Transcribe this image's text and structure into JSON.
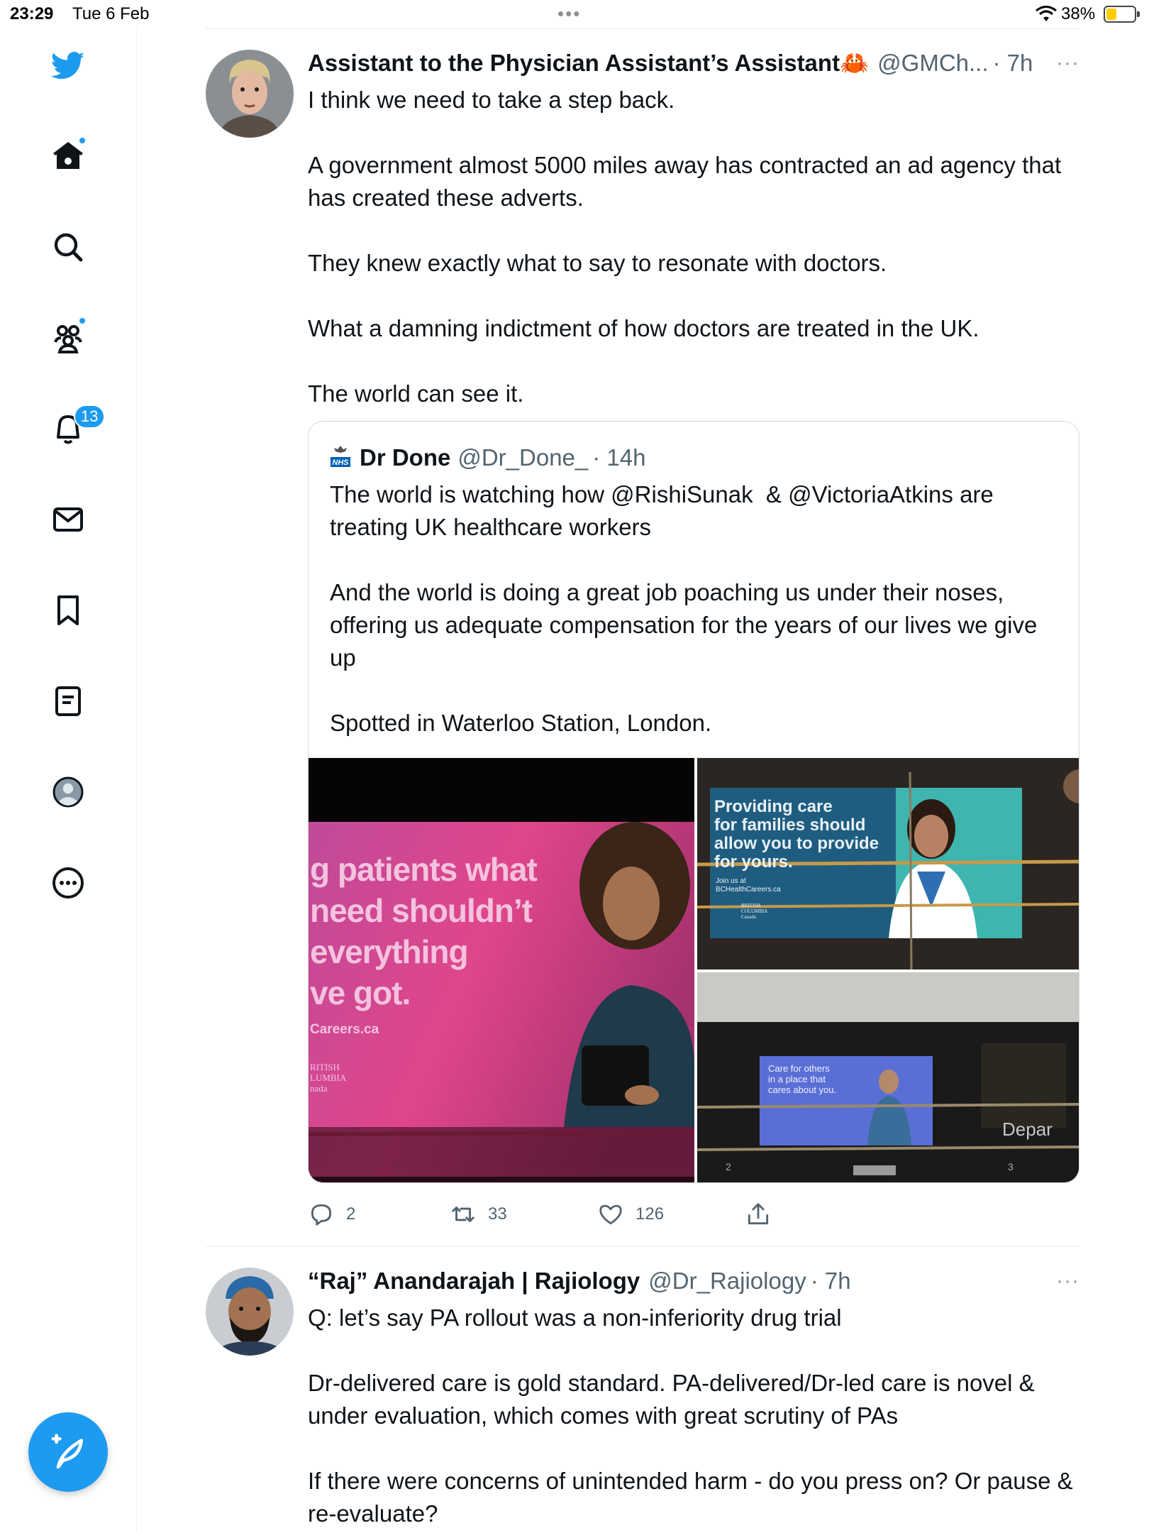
{
  "status_bar": {
    "time": "23:29",
    "date": "Tue 6 Feb",
    "battery_percent": "38%",
    "battery_level": 0.38
  },
  "sidebar": {
    "items": [
      {
        "name": "logo",
        "icon": "twitter-bird-icon"
      },
      {
        "name": "home",
        "icon": "home-icon",
        "dot": true
      },
      {
        "name": "explore",
        "icon": "search-icon"
      },
      {
        "name": "communities",
        "icon": "communities-icon",
        "dot": true
      },
      {
        "name": "notifications",
        "icon": "bell-icon",
        "badge": "13"
      },
      {
        "name": "messages",
        "icon": "mail-icon"
      },
      {
        "name": "bookmarks",
        "icon": "bookmark-icon"
      },
      {
        "name": "lists",
        "icon": "list-icon"
      },
      {
        "name": "profile",
        "icon": "profile-icon"
      },
      {
        "name": "more",
        "icon": "more-circle-icon"
      }
    ],
    "compose_icon": "compose-feather-icon"
  },
  "tweets": [
    {
      "name": "Assistant to the Physician Assistant’s Assistant🦀",
      "handle": "@GMCh...",
      "time": "· 7h",
      "more": "···",
      "text": "I think we need to take a step back.\n\nA government almost 5000 miles away has contracted an ad agency that has created these adverts.\n\nThey knew exactly what to say to resonate with doctors.\n\nWhat a damning indictment of how doctors are treated in the UK.\n\nThe world can see it.",
      "quote": {
        "name": "Dr Done",
        "handle": "@Dr_Done_",
        "time": "· 14h",
        "badge": "NHS",
        "text": "The world is watching how @RishiSunak  & @VictoriaAtkins are treating UK healthcare workers\n\nAnd the world is doing a great job poaching us under their noses, offering us adequate compensation for the years of our lives we give up\n\nSpotted in Waterloo Station, London.",
        "images": [
          {
            "lines": [
              "g patients what",
              "need shouldn’t",
              "everything",
              "ve got."
            ],
            "footer": "Careers.ca",
            "footer2": [
              "RITISH",
              "LUMBIA",
              "nada"
            ]
          },
          {
            "lines": [
              "Providing care",
              "for families should",
              "allow you to provide",
              "for yours."
            ],
            "footer": "Join us at",
            "footer_url": "BCHealthCareers.ca",
            "footer2": [
              "BRITISH",
              "COLUMBIA",
              "Canada"
            ]
          },
          {
            "lines": [
              "Care for others",
              "in a place that",
              "cares about you."
            ],
            "sign": "Depar",
            "numbers": [
              "2",
              "3"
            ]
          }
        ]
      },
      "actions": {
        "replies": "2",
        "retweets": "33",
        "likes": "126"
      }
    },
    {
      "name": "“Raj” Anandarajah | Rajiology",
      "handle": "@Dr_Rajiology",
      "time": "· 7h",
      "more": "···",
      "text": "Q: let’s say PA rollout was a non-inferiority drug trial\n\nDr-delivered care is gold standard. PA-delivered/Dr-led care is novel & under evaluation, which comes with great scrutiny of PAs\n\nIf there were concerns of unintended harm - do you press on? Or pause & re-evaluate?"
    }
  ],
  "colors": {
    "accent": "#1d9bf0",
    "text": "#0f1419",
    "secondary": "#536471",
    "border": "#cfd9de"
  }
}
